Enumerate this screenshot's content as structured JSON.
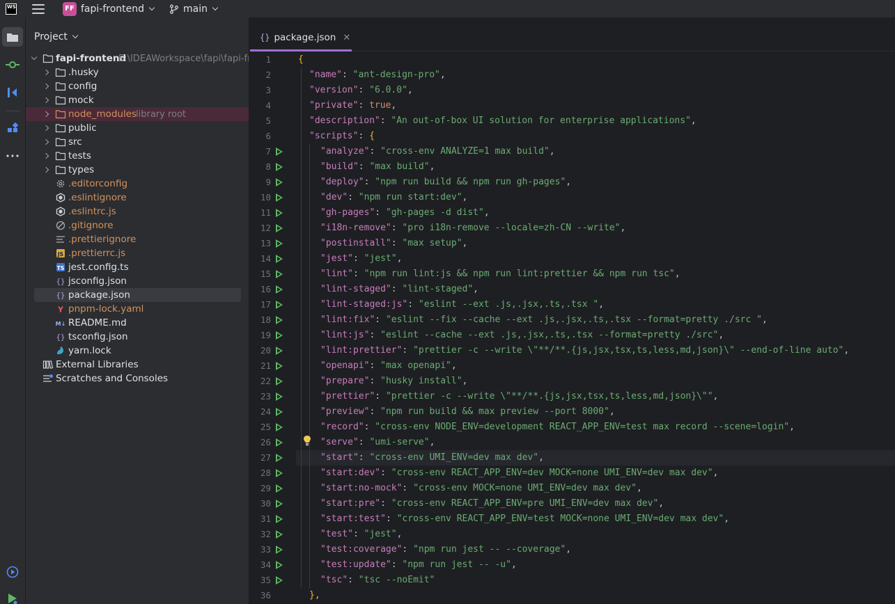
{
  "titlebar": {
    "logo_text": "WS",
    "project_badge": "FF",
    "project_name": "fapi-frontend",
    "branch": "main"
  },
  "colors": {
    "accent": "#a06fd8",
    "project_badge": "#c94f9b",
    "key": "#c77dbb",
    "string": "#6aab73",
    "keyword": "#cf8e6d",
    "run_icon": "#5fb865"
  },
  "toolstrip": {
    "items": [
      "folder-icon",
      "commit-icon",
      "pull-requests-icon",
      "plugins-icon",
      "more-icon",
      "services-icon",
      "run-icon"
    ]
  },
  "project_panel": {
    "title": "Project",
    "root": {
      "name": "fapi-frontend",
      "path": "E:\\IDEAWorkspace\\fapi\\fapi-fr"
    },
    "folders": [
      {
        "name": ".husky"
      },
      {
        "name": "config"
      },
      {
        "name": "mock"
      },
      {
        "name": "node_modules",
        "note": "library root"
      },
      {
        "name": "public"
      },
      {
        "name": "src"
      },
      {
        "name": "tests"
      },
      {
        "name": "types"
      }
    ],
    "files": [
      {
        "name": ".editorconfig",
        "icon": "gear-icon"
      },
      {
        "name": ".eslintignore",
        "icon": "eslint-icon"
      },
      {
        "name": ".eslintrc.js",
        "icon": "eslint-icon"
      },
      {
        "name": ".gitignore",
        "icon": "ignore-icon"
      },
      {
        "name": ".prettierignore",
        "icon": "text-lines-icon"
      },
      {
        "name": ".prettierrc.js",
        "icon": "js-icon"
      },
      {
        "name": "jest.config.ts",
        "icon": "ts-icon"
      },
      {
        "name": "jsconfig.json",
        "icon": "json-icon"
      },
      {
        "name": "package.json",
        "icon": "json-icon"
      },
      {
        "name": "pnpm-lock.yaml",
        "icon": "yaml-icon"
      },
      {
        "name": "README.md",
        "icon": "markdown-icon"
      },
      {
        "name": "tsconfig.json",
        "icon": "json-icon"
      },
      {
        "name": "yarn.lock",
        "icon": "yarn-icon"
      }
    ],
    "extra": [
      {
        "name": "External Libraries",
        "icon": "library-icon"
      },
      {
        "name": "Scratches and Consoles",
        "icon": "scratches-icon"
      }
    ]
  },
  "editor": {
    "tab_label": "package.json",
    "tab_icon_text": "{}",
    "current_line": 27,
    "lines": [
      {
        "n": "1",
        "run": false,
        "text": "{",
        "kind": "open"
      },
      {
        "n": "2",
        "run": false,
        "k": "name",
        "v": "ant-design-pro",
        "end": ","
      },
      {
        "n": "3",
        "run": false,
        "k": "version",
        "v": "6.0.0",
        "end": ","
      },
      {
        "n": "4",
        "run": false,
        "k": "private",
        "lit": "true",
        "end": ","
      },
      {
        "n": "5",
        "run": false,
        "k": "description",
        "v": "An out-of-box UI solution for enterprise applications",
        "end": ","
      },
      {
        "n": "6",
        "run": false,
        "k": "scripts",
        "obj": "{"
      },
      {
        "n": "7",
        "run": true,
        "k": "analyze",
        "v": "cross-env ANALYZE=1 max build",
        "end": ","
      },
      {
        "n": "8",
        "run": true,
        "k": "build",
        "v": "max build",
        "end": ","
      },
      {
        "n": "9",
        "run": true,
        "k": "deploy",
        "v": "npm run build && npm run gh-pages",
        "end": ","
      },
      {
        "n": "10",
        "run": true,
        "k": "dev",
        "v": "npm run start:dev",
        "end": ","
      },
      {
        "n": "11",
        "run": true,
        "k": "gh-pages",
        "v": "gh-pages -d dist",
        "end": ","
      },
      {
        "n": "12",
        "run": true,
        "k": "i18n-remove",
        "v": "pro i18n-remove --locale=zh-CN --write",
        "end": ","
      },
      {
        "n": "13",
        "run": true,
        "k": "postinstall",
        "v": "max setup",
        "end": ","
      },
      {
        "n": "14",
        "run": true,
        "k": "jest",
        "v": "jest",
        "end": ","
      },
      {
        "n": "15",
        "run": true,
        "k": "lint",
        "v": "npm run lint:js && npm run lint:prettier && npm run tsc",
        "end": ","
      },
      {
        "n": "16",
        "run": true,
        "k": "lint-staged",
        "v": "lint-staged",
        "end": ","
      },
      {
        "n": "17",
        "run": true,
        "k": "lint-staged:js",
        "v": "eslint --ext .js,.jsx,.ts,.tsx ",
        "end": ","
      },
      {
        "n": "18",
        "run": true,
        "k": "lint:fix",
        "v": "eslint --fix --cache --ext .js,.jsx,.ts,.tsx --format=pretty ./src ",
        "end": ","
      },
      {
        "n": "19",
        "run": true,
        "k": "lint:js",
        "v": "eslint --cache --ext .js,.jsx,.ts,.tsx --format=pretty ./src",
        "end": ","
      },
      {
        "n": "20",
        "run": true,
        "k": "lint:prettier",
        "v": "prettier -c --write \\\"**/**.{js,jsx,tsx,ts,less,md,json}\\\" --end-of-line auto",
        "end": ","
      },
      {
        "n": "21",
        "run": true,
        "k": "openapi",
        "v": "max openapi",
        "end": ","
      },
      {
        "n": "22",
        "run": true,
        "k": "prepare",
        "v": "husky install",
        "end": ","
      },
      {
        "n": "23",
        "run": true,
        "k": "prettier",
        "v": "prettier -c --write \\\"**/**.{js,jsx,tsx,ts,less,md,json}\\\"",
        "end": ","
      },
      {
        "n": "24",
        "run": true,
        "k": "preview",
        "v": "npm run build && max preview --port 8000",
        "end": ","
      },
      {
        "n": "25",
        "run": true,
        "k": "record",
        "v": "cross-env NODE_ENV=development REACT_APP_ENV=test max record --scene=login",
        "end": ","
      },
      {
        "n": "26",
        "run": true,
        "k": "serve",
        "v": "umi-serve",
        "end": ","
      },
      {
        "n": "27",
        "run": true,
        "k": "start",
        "v": "cross-env UMI_ENV=dev max dev",
        "end": ","
      },
      {
        "n": "28",
        "run": true,
        "k": "start:dev",
        "v": "cross-env REACT_APP_ENV=dev MOCK=none UMI_ENV=dev max dev",
        "end": ","
      },
      {
        "n": "29",
        "run": true,
        "k": "start:no-mock",
        "v": "cross-env MOCK=none UMI_ENV=dev max dev",
        "end": ","
      },
      {
        "n": "30",
        "run": true,
        "k": "start:pre",
        "v": "cross-env REACT_APP_ENV=pre UMI_ENV=dev max dev",
        "end": ","
      },
      {
        "n": "31",
        "run": true,
        "k": "start:test",
        "v": "cross-env REACT_APP_ENV=test MOCK=none UMI_ENV=dev max dev",
        "end": ","
      },
      {
        "n": "32",
        "run": true,
        "k": "test",
        "v": "jest",
        "end": ","
      },
      {
        "n": "33",
        "run": true,
        "k": "test:coverage",
        "v": "npm run jest -- --coverage",
        "end": ","
      },
      {
        "n": "34",
        "run": true,
        "k": "test:update",
        "v": "npm run jest -- -u",
        "end": ","
      },
      {
        "n": "35",
        "run": true,
        "k": "tsc",
        "v": "tsc --noEmit",
        "end": ""
      },
      {
        "n": "36",
        "run": false,
        "text": "},",
        "kind": "close"
      }
    ]
  }
}
